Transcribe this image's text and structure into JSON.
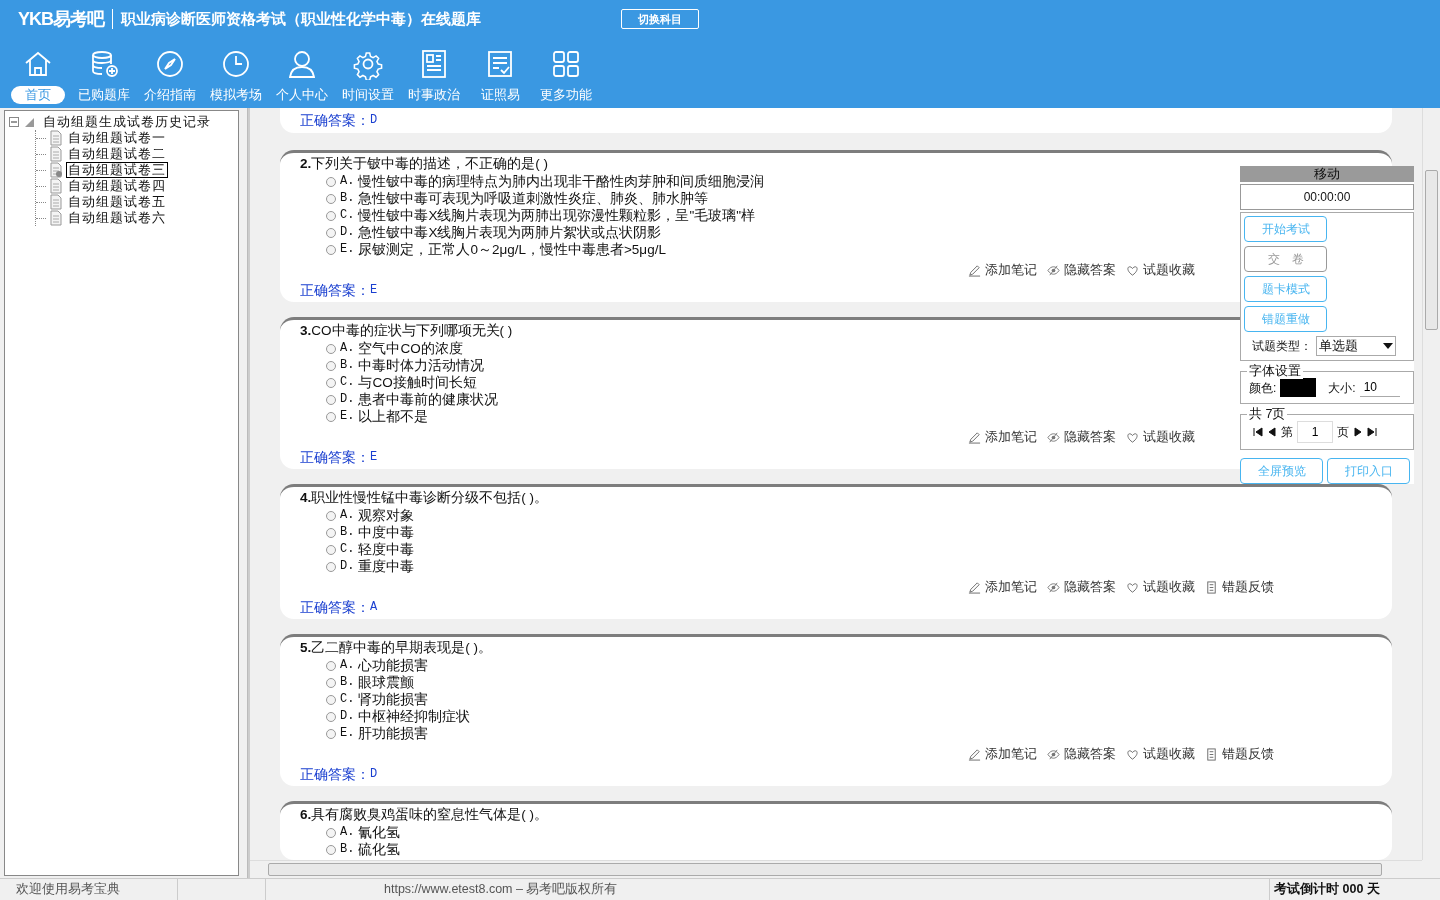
{
  "header": {
    "logo": "YKB易考吧",
    "title": "职业病诊断医师资格考试（职业性化学中毒）在线题库",
    "switch_button": "切换科目"
  },
  "nav": [
    {
      "label": "首页",
      "selected": true
    },
    {
      "label": "已购题库",
      "selected": false
    },
    {
      "label": "介绍指南",
      "selected": false
    },
    {
      "label": "模拟考场",
      "selected": false
    },
    {
      "label": "个人中心",
      "selected": false
    },
    {
      "label": "时间设置",
      "selected": false
    },
    {
      "label": "时事政治",
      "selected": false
    },
    {
      "label": "证照易",
      "selected": false
    },
    {
      "label": "更多功能",
      "selected": false
    }
  ],
  "tree": {
    "label": "自动组题生成试卷历史记录",
    "expanded": true,
    "children": [
      {
        "label": "自动组题试卷一",
        "selected": false
      },
      {
        "label": "自动组题试卷二",
        "selected": false
      },
      {
        "label": "自动组题试卷三",
        "selected": true
      },
      {
        "label": "自动组题试卷四",
        "selected": false
      },
      {
        "label": "自动组题试卷五",
        "selected": false
      },
      {
        "label": "自动组题试卷六",
        "selected": false
      }
    ]
  },
  "previous_answer": {
    "label": "正确答案：",
    "value": "D"
  },
  "questions": [
    {
      "number": "2.",
      "text": "下列关于铍中毒的描述，不正确的是( )",
      "options": [
        {
          "letter": "A.",
          "text": "慢性铍中毒的病理特点为肺内出现非干酪性肉芽肿和间质细胞浸润",
          "selected": false
        },
        {
          "letter": "B.",
          "text": "急性铍中毒可表现为呼吸道刺激性炎症、肺炎、肺水肿等",
          "selected": false
        },
        {
          "letter": "C.",
          "text": "慢性铍中毒X线胸片表现为两肺出现弥漫性颗粒影，呈\"毛玻璃\"样",
          "selected": false
        },
        {
          "letter": "D.",
          "text": "急性铍中毒X线胸片表现为两肺片絮状或点状阴影",
          "selected": false
        },
        {
          "letter": "E.",
          "text": "尿铍测定，正常人0～2μg/L，慢性中毒患者>5μg/L",
          "selected": false
        }
      ],
      "actions": [
        {
          "kind": "note",
          "label": "添加笔记"
        },
        {
          "kind": "hide",
          "label": "隐藏答案"
        },
        {
          "kind": "favorite",
          "label": "试题收藏"
        }
      ],
      "answer_label": "正确答案：",
      "answer": "E"
    },
    {
      "number": "3.",
      "text": "CO中毒的症状与下列哪项无关( )",
      "options": [
        {
          "letter": "A.",
          "text": "空气中CO的浓度",
          "selected": false
        },
        {
          "letter": "B.",
          "text": "中毒时体力活动情况",
          "selected": false
        },
        {
          "letter": "C.",
          "text": "与CO接触时间长短",
          "selected": false
        },
        {
          "letter": "D.",
          "text": "患者中毒前的健康状况",
          "selected": false
        },
        {
          "letter": "E.",
          "text": "以上都不是",
          "selected": false
        }
      ],
      "actions": [
        {
          "kind": "note",
          "label": "添加笔记"
        },
        {
          "kind": "hide",
          "label": "隐藏答案"
        },
        {
          "kind": "favorite",
          "label": "试题收藏"
        }
      ],
      "answer_label": "正确答案：",
      "answer": "E"
    },
    {
      "number": "4.",
      "text": "职业性慢性锰中毒诊断分级不包括( )。",
      "options": [
        {
          "letter": "A.",
          "text": "观察对象",
          "selected": false
        },
        {
          "letter": "B.",
          "text": "中度中毒",
          "selected": false
        },
        {
          "letter": "C.",
          "text": "轻度中毒",
          "selected": false
        },
        {
          "letter": "D.",
          "text": "重度中毒",
          "selected": false
        }
      ],
      "actions": [
        {
          "kind": "note",
          "label": "添加笔记"
        },
        {
          "kind": "hide",
          "label": "隐藏答案"
        },
        {
          "kind": "favorite",
          "label": "试题收藏"
        },
        {
          "kind": "feedback",
          "label": "错题反馈"
        }
      ],
      "answer_label": "正确答案：",
      "answer": "A"
    },
    {
      "number": "5.",
      "text": "乙二醇中毒的早期表现是( )。",
      "options": [
        {
          "letter": "A.",
          "text": "心功能损害",
          "selected": false
        },
        {
          "letter": "B.",
          "text": "眼球震颤",
          "selected": false
        },
        {
          "letter": "C.",
          "text": "肾功能损害",
          "selected": false
        },
        {
          "letter": "D.",
          "text": "中枢神经抑制症状",
          "selected": false
        },
        {
          "letter": "E.",
          "text": "肝功能损害",
          "selected": false
        }
      ],
      "actions": [
        {
          "kind": "note",
          "label": "添加笔记"
        },
        {
          "kind": "hide",
          "label": "隐藏答案"
        },
        {
          "kind": "favorite",
          "label": "试题收藏"
        },
        {
          "kind": "feedback",
          "label": "错题反馈"
        }
      ],
      "answer_label": "正确答案：",
      "answer": "D"
    },
    {
      "number": "6.",
      "text": "具有腐败臭鸡蛋味的窒息性气体是( )。",
      "options": [
        {
          "letter": "A.",
          "text": "氰化氢",
          "selected": false
        },
        {
          "letter": "B.",
          "text": "硫化氢",
          "selected": false
        }
      ]
    }
  ],
  "panel": {
    "title": "移动",
    "timer": "00:00:00",
    "buttons": [
      {
        "label": "开始考试",
        "disabled": false
      },
      {
        "label": "交　卷",
        "disabled": true
      },
      {
        "label": "题卡模式",
        "disabled": false
      },
      {
        "label": "错题重做",
        "disabled": false
      }
    ],
    "type_label": "试题类型：",
    "type_value": "单选题",
    "font_legend": "字体设置",
    "color_label": "颜色:",
    "color": "#000000",
    "size_label": "大小:",
    "size_value": "10",
    "pager_legend": "共 7页",
    "page_prefix": "第",
    "page_value": "1",
    "page_suffix": "页",
    "bottom_buttons": [
      "全屏预览",
      "打印入口"
    ]
  },
  "status_bar": {
    "welcome": "欢迎使用易考宝典",
    "copyright": "https://www.etest8.com – 易考吧版权所有",
    "countdown": "考试倒计时 000 天"
  }
}
